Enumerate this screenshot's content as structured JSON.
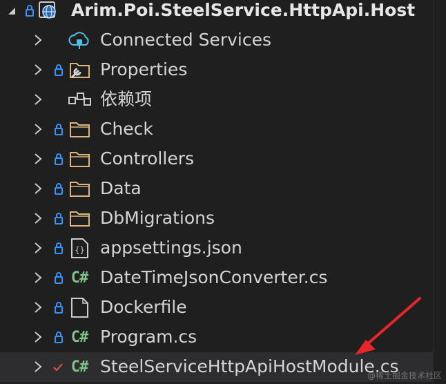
{
  "solution_explorer": {
    "project": {
      "name": "Arim.Poi.SteelService.HttpApi.Host",
      "expanded": true
    },
    "items": [
      {
        "label": "Connected Services",
        "icon": "connected-services-icon",
        "locked": false,
        "kind": "node"
      },
      {
        "label": "Properties",
        "icon": "properties-folder-icon",
        "locked": true,
        "kind": "node"
      },
      {
        "label": "依赖项",
        "icon": "dependencies-icon",
        "locked": false,
        "kind": "node"
      },
      {
        "label": "Check",
        "icon": "folder-icon",
        "locked": true,
        "kind": "folder"
      },
      {
        "label": "Controllers",
        "icon": "folder-icon",
        "locked": true,
        "kind": "folder"
      },
      {
        "label": "Data",
        "icon": "folder-icon",
        "locked": true,
        "kind": "folder"
      },
      {
        "label": "DbMigrations",
        "icon": "folder-icon",
        "locked": true,
        "kind": "folder"
      },
      {
        "label": "appsettings.json",
        "icon": "json-file-icon",
        "locked": true,
        "kind": "file"
      },
      {
        "label": "DateTimeJsonConverter.cs",
        "icon": "csharp-file-icon",
        "locked": true,
        "kind": "file"
      },
      {
        "label": "Dockerfile",
        "icon": "file-icon",
        "locked": true,
        "kind": "file"
      },
      {
        "label": "Program.cs",
        "icon": "csharp-file-icon",
        "locked": true,
        "kind": "file"
      },
      {
        "label": "SteelServiceHttpApiHostModule.cs",
        "icon": "csharp-file-icon",
        "locked": false,
        "checked": true,
        "kind": "file"
      }
    ],
    "csharp_glyph": "C#",
    "json_glyph": "{}"
  },
  "watermark": "@稀土掘金技术社区",
  "colors": {
    "background": "#1f1f1f",
    "selected_row": "#2d2d30",
    "text": "#d4d4d4",
    "lock": "#3794ff",
    "folder": "#dcb67a",
    "csharp": "#7ec287",
    "check": "#e05252",
    "annotation_arrow": "#e8262a"
  }
}
